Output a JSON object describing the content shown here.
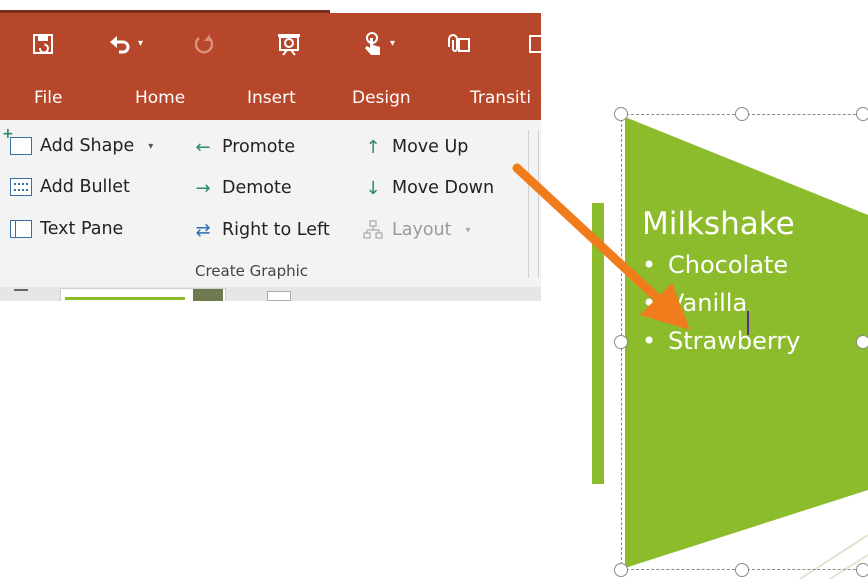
{
  "colors": {
    "ribbon_red": "#b7472a",
    "smartart_green": "#8cbb2b",
    "annotation_orange": "#f07c1b"
  },
  "quick_access": {
    "icons": [
      "save-icon",
      "undo-icon",
      "redo-icon",
      "slideshow-icon",
      "touch-mode-icon",
      "attach-icon"
    ]
  },
  "tabs": [
    "File",
    "Home",
    "Insert",
    "Design",
    "Transiti"
  ],
  "ribbon": {
    "column1": [
      "Add Shape",
      "Add Bullet",
      "Text Pane"
    ],
    "column2": [
      "Promote",
      "Demote",
      "Right to Left"
    ],
    "column3": [
      "Move Up",
      "Move Down",
      "Layout"
    ],
    "group_label": "Create Graphic"
  },
  "smartart": {
    "title": "Milkshake",
    "bullets": [
      "Chocolate",
      "Vanilla",
      "Strawberry"
    ]
  }
}
